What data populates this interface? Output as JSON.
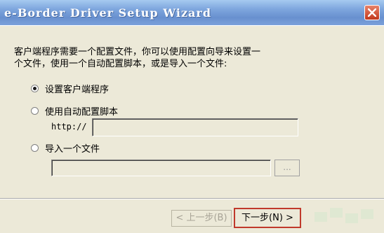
{
  "window": {
    "title": "e-Border Driver Setup Wizard"
  },
  "instructions": {
    "line1": "客户端程序需要一个配置文件，你可以使用配置向导来设置一",
    "line2": "个文件，使用一个自动配置脚本，或是导入一个文件:"
  },
  "options": [
    {
      "label": "设置客户端程序",
      "checked": true
    },
    {
      "label": "使用自动配置脚本",
      "checked": false
    },
    {
      "label": "导入一个文件",
      "checked": false
    }
  ],
  "auto_config": {
    "prefix": "http://",
    "value": ""
  },
  "import": {
    "value": "",
    "browse_label": "..."
  },
  "buttons": {
    "back": "< 上一步(B)",
    "next": "下一步(N) >"
  }
}
